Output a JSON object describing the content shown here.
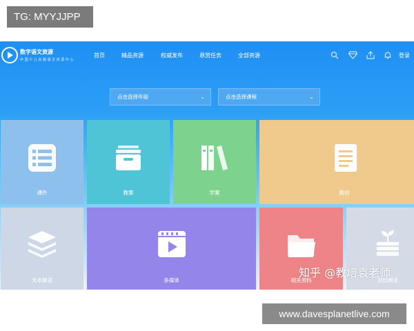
{
  "overlay": {
    "tag": "TG: MYYJJPP",
    "url": "www.davesplanetlive.com",
    "watermark": "知乎 @教培袁老师"
  },
  "header": {
    "logo_title": "数字语文资源",
    "logo_subtitle": "中 国 少 儿 出 版 语 文 资 源 中 心",
    "nav": [
      "首页",
      "精品资源",
      "权威发布",
      "悬赏任务",
      "全部资源"
    ],
    "icons": [
      "search-icon",
      "diamond-icon",
      "upload-icon",
      "bell-icon"
    ],
    "login": "登录"
  },
  "filters": {
    "grade_placeholder": "点击选择年级",
    "course_placeholder": "点击选择课程"
  },
  "tiles": [
    {
      "label": "课件",
      "icon": "list-icon",
      "color": "#8ec0ee"
    },
    {
      "label": "教案",
      "icon": "archive-box-icon",
      "color": "#4fc4d7"
    },
    {
      "label": "学案",
      "icon": "books-icon",
      "color": "#7dd38e"
    },
    {
      "label": "教材",
      "icon": "document-icon",
      "color": "#f0ca8c"
    },
    {
      "label": "文本解读",
      "icon": "layers-icon",
      "color": "#cdd7e6"
    },
    {
      "label": "多媒体",
      "icon": "video-icon",
      "color": "#9385e9"
    },
    {
      "label": "相关资料",
      "icon": "folder-icon",
      "color": "#ee8487"
    },
    {
      "label": "对比阅读",
      "icon": "plant-icon",
      "color": "#d4dbe6"
    }
  ]
}
